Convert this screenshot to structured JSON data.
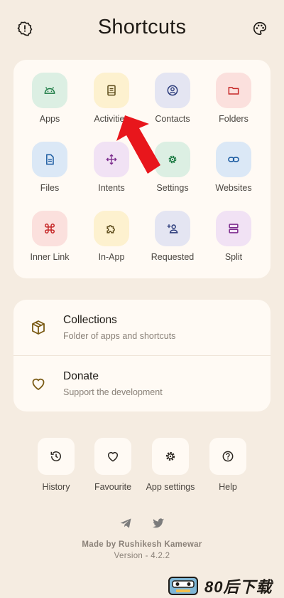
{
  "header": {
    "title": "Shortcuts",
    "left_icon": "info-alert-icon",
    "right_icon": "palette-icon"
  },
  "grid": [
    {
      "label": "Apps",
      "icon": "android-icon",
      "bg": "#dcefe3",
      "fg": "#1b7a43"
    },
    {
      "label": "Activities",
      "icon": "document-icon",
      "bg": "#fdf1cf",
      "fg": "#5c4b1a"
    },
    {
      "label": "Contacts",
      "icon": "account-circle-icon",
      "bg": "#e4e5f2",
      "fg": "#2a3a7a"
    },
    {
      "label": "Folders",
      "icon": "folder-icon",
      "bg": "#fbe0dd",
      "fg": "#c62828"
    },
    {
      "label": "Files",
      "icon": "file-icon",
      "bg": "#dbe8f6",
      "fg": "#1a5aa0"
    },
    {
      "label": "Intents",
      "icon": "move-arrows-icon",
      "bg": "#f1e2f4",
      "fg": "#7b2a8c"
    },
    {
      "label": "Settings",
      "icon": "gear-icon",
      "bg": "#dcefe3",
      "fg": "#1b7a43"
    },
    {
      "label": "Websites",
      "icon": "link-icon",
      "bg": "#dbe8f6",
      "fg": "#1a5aa0"
    },
    {
      "label": "Inner Link",
      "icon": "command-key-icon",
      "bg": "#fbe0dd",
      "fg": "#c62828"
    },
    {
      "label": "In-App",
      "icon": "puzzle-icon",
      "bg": "#fdf1cf",
      "fg": "#5c4b1a"
    },
    {
      "label": "Requested",
      "icon": "person-add-icon",
      "bg": "#e4e5f2",
      "fg": "#2a3a7a"
    },
    {
      "label": "Split",
      "icon": "split-view-icon",
      "bg": "#f1e2f4",
      "fg": "#7b2a8c"
    }
  ],
  "list": [
    {
      "title": "Collections",
      "subtitle": "Folder of apps and shortcuts",
      "icon": "box-icon"
    },
    {
      "title": "Donate",
      "subtitle": "Support the development",
      "icon": "heart-outline-icon"
    }
  ],
  "bottom": [
    {
      "label": "History",
      "icon": "history-icon"
    },
    {
      "label": "Favourite",
      "icon": "heart-icon"
    },
    {
      "label": "App settings",
      "icon": "app-settings-icon"
    },
    {
      "label": "Help",
      "icon": "help-icon"
    }
  ],
  "social": [
    "telegram-icon",
    "twitter-icon"
  ],
  "footer": {
    "made_by": "Made by Rushikesh Kamewar",
    "version": "Version - 4.2.2"
  },
  "watermark": {
    "text": "80后下载"
  },
  "colors": {
    "background": "#f5ece1",
    "card": "#fffaf4",
    "arrow": "#e8161c",
    "brown_icon": "#7a5a14"
  }
}
